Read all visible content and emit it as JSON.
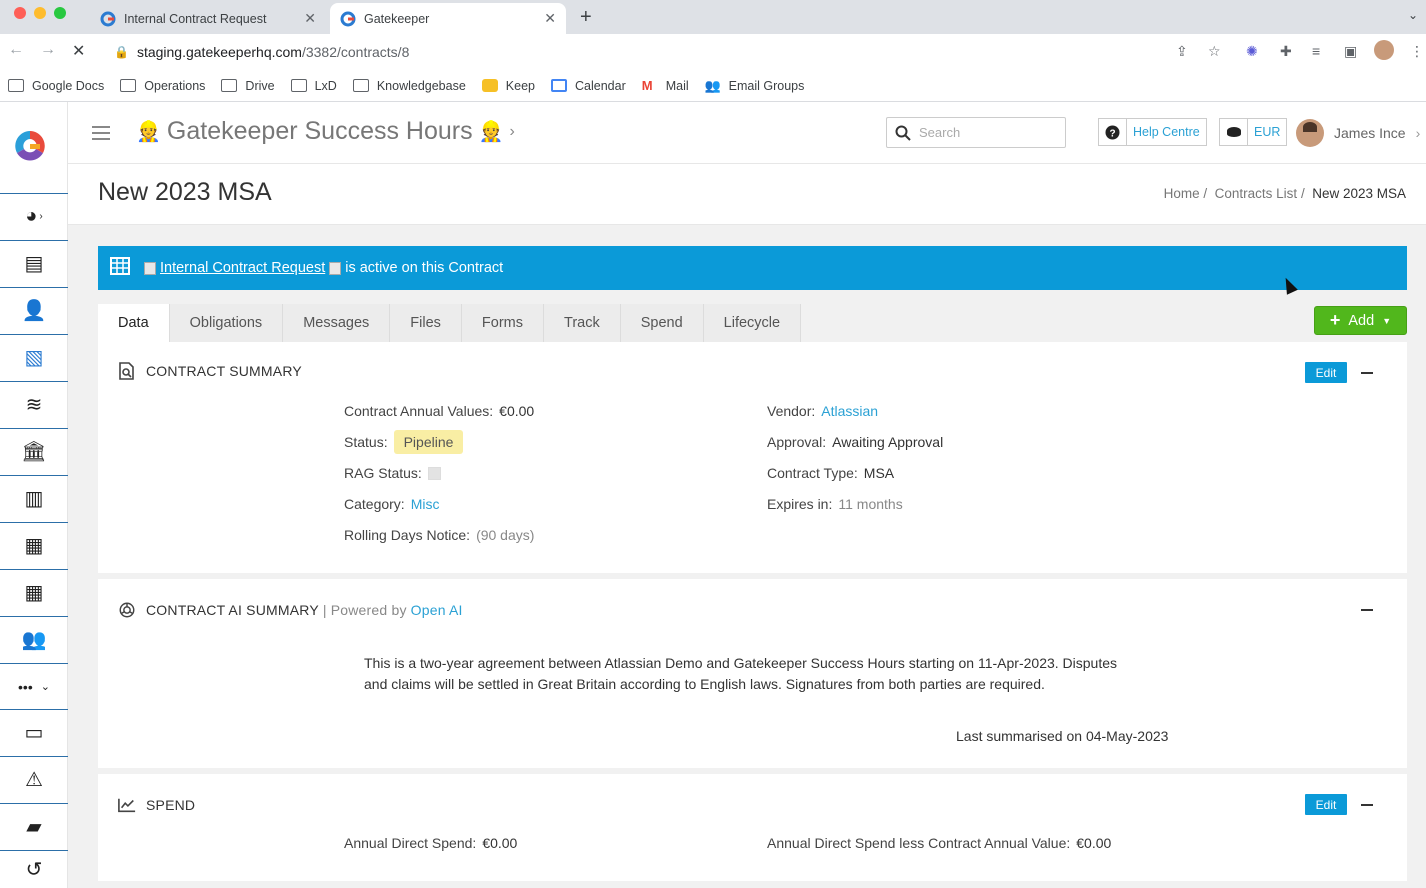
{
  "browser": {
    "tabs": [
      {
        "title": "Internal Contract Request"
      },
      {
        "title": "Gatekeeper"
      }
    ],
    "url_host": "staging.gatekeeperhq.com",
    "url_path": "/3382/contracts/8",
    "bookmarks": [
      "Google Docs",
      "Operations",
      "Drive",
      "LxD",
      "Knowledgebase",
      "Keep",
      "Calendar",
      "Mail",
      "Email Groups"
    ]
  },
  "header": {
    "app_title": "Gatekeeper Success Hours",
    "search_placeholder": "Search",
    "help_label": "Help Centre",
    "currency_label": "EUR",
    "user_name": "James Ince"
  },
  "page": {
    "title": "New 2023 MSA",
    "breadcrumb": [
      "Home",
      "Contracts List",
      "New 2023 MSA"
    ]
  },
  "banner": {
    "link_text": "Internal Contract Request",
    "suffix": "is active on this Contract"
  },
  "tabs": [
    "Data",
    "Obligations",
    "Messages",
    "Files",
    "Forms",
    "Track",
    "Spend",
    "Lifecycle"
  ],
  "add_button": "Add",
  "contract_summary": {
    "heading": "CONTRACT SUMMARY",
    "edit_label": "Edit",
    "annual_values_label": "Contract Annual Values:",
    "annual_values": "€0.00",
    "status_label": "Status:",
    "status": "Pipeline",
    "rag_label": "RAG Status:",
    "category_label": "Category:",
    "category": "Misc",
    "rolling_label": "Rolling Days Notice:",
    "rolling": "(90 days)",
    "vendor_label": "Vendor:",
    "vendor": "Atlassian",
    "approval_label": "Approval:",
    "approval": "Awaiting Approval",
    "type_label": "Contract Type:",
    "type": "MSA",
    "expires_label": "Expires in:",
    "expires": "11 months"
  },
  "ai_summary": {
    "heading": "CONTRACT AI SUMMARY",
    "separator": "|",
    "powered_by": "Powered by",
    "provider": "Open AI",
    "text": "This is a two-year agreement between Atlassian Demo and Gatekeeper Success Hours starting on 11-Apr-2023. Disputes and claims will be settled in Great Britain according to English laws. Signatures from both parties are required.",
    "last_summarised": "Last summarised on 04-May-2023"
  },
  "spend": {
    "heading": "SPEND",
    "edit_label": "Edit",
    "annual_direct_label": "Annual Direct Spend:",
    "annual_direct": "€0.00",
    "less_label": "Annual Direct Spend less Contract Annual Value:",
    "less_value": "€0.00"
  },
  "colors": {
    "accent": "#0b9ad8",
    "add_green": "#51b71c",
    "status_pill": "#f9eea4"
  }
}
